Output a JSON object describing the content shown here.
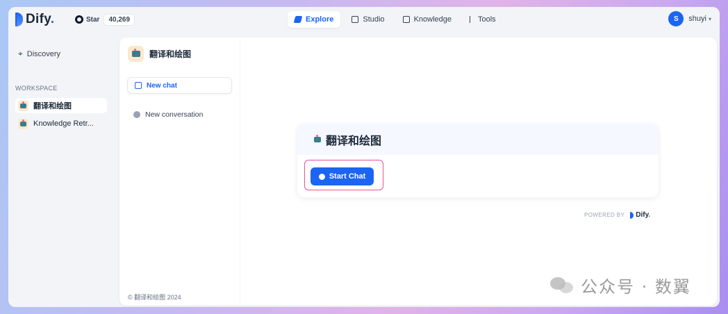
{
  "header": {
    "logo_text": "Dify",
    "logo_dot": ".",
    "github_star_label": "Star",
    "github_star_count": "40,269",
    "nav": [
      {
        "label": "Explore",
        "icon": "explore-icon",
        "active": true
      },
      {
        "label": "Studio",
        "icon": "robot-icon",
        "active": false
      },
      {
        "label": "Knowledge",
        "icon": "book-icon",
        "active": false
      },
      {
        "label": "Tools",
        "icon": "hammer-icon",
        "active": false
      }
    ],
    "user": {
      "initial": "S",
      "name": "shuyi"
    }
  },
  "sidebar": {
    "discovery_label": "Discovery",
    "workspace_label": "WORKSPACE",
    "items": [
      {
        "label": "翻译和绘图",
        "active": true
      },
      {
        "label": "Knowledge Retr...",
        "active": false
      }
    ]
  },
  "chat_panel": {
    "app_name": "翻译和绘图",
    "new_chat_label": "New chat",
    "conversations": [
      {
        "label": "New conversation"
      }
    ],
    "footer": "© 翻译和绘图 2024"
  },
  "main": {
    "card_title": "翻译和绘图",
    "start_chat_label": "Start Chat",
    "powered_by_label": "POWERED BY",
    "powered_logo_text": "Dify",
    "powered_logo_dot": "."
  },
  "watermark": {
    "text": "公众号 · 数翼"
  },
  "colors": {
    "accent": "#1c64f2",
    "highlight_border": "#ea4f96"
  }
}
